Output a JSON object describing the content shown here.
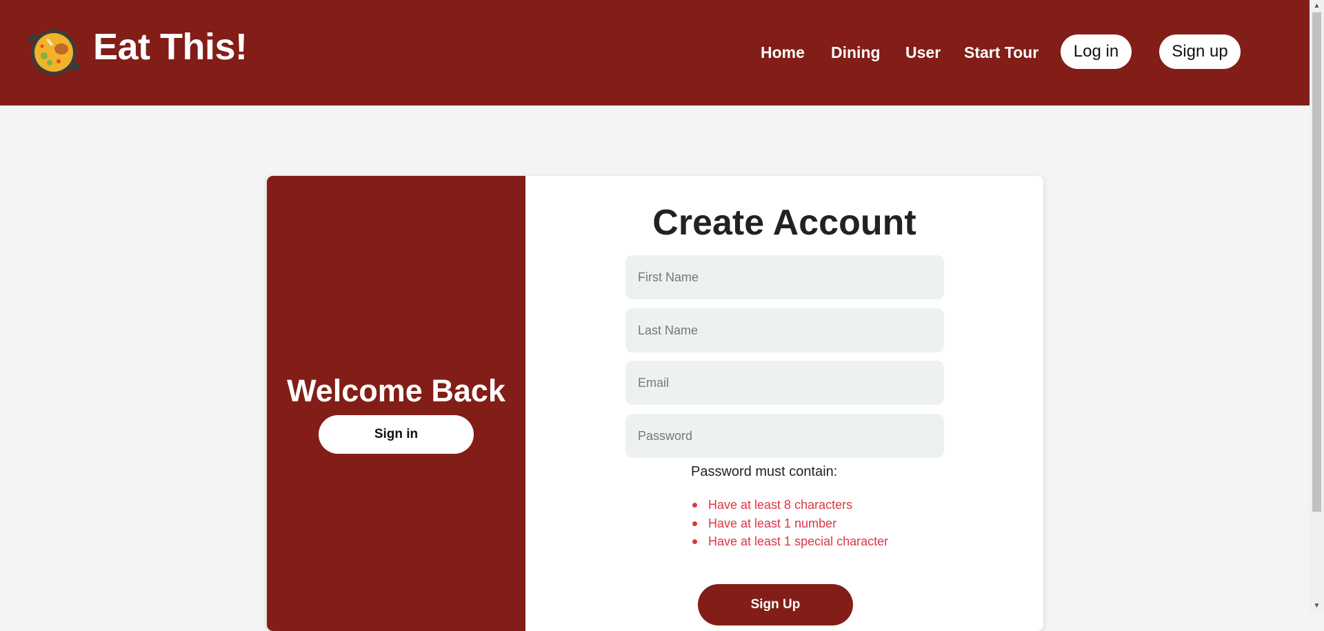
{
  "header": {
    "brand_name": "Eat This!",
    "logo_icon": "paella-pan-icon",
    "nav": [
      {
        "label": "Home"
      },
      {
        "label": "Dining"
      },
      {
        "label": "User"
      },
      {
        "label": "Start Tour"
      }
    ],
    "login_label": "Log in",
    "signup_label": "Sign up"
  },
  "overlay": {
    "title": "Welcome Back",
    "signin_label": "Sign in"
  },
  "form": {
    "title": "Create Account",
    "first_name": {
      "placeholder": "First Name",
      "value": ""
    },
    "last_name": {
      "placeholder": "Last Name",
      "value": ""
    },
    "email": {
      "placeholder": "Email",
      "value": ""
    },
    "password": {
      "placeholder": "Password",
      "value": ""
    },
    "requirements_title": "Password must contain:",
    "requirements": [
      "Have at least 8 characters",
      "Have at least 1 number",
      "Have at least 1 special character"
    ],
    "submit_label": "Sign Up"
  },
  "colors": {
    "brand": "#821e17",
    "background": "#f4f4f4",
    "input_bg": "#edf2f0",
    "error": "#dc3545"
  }
}
